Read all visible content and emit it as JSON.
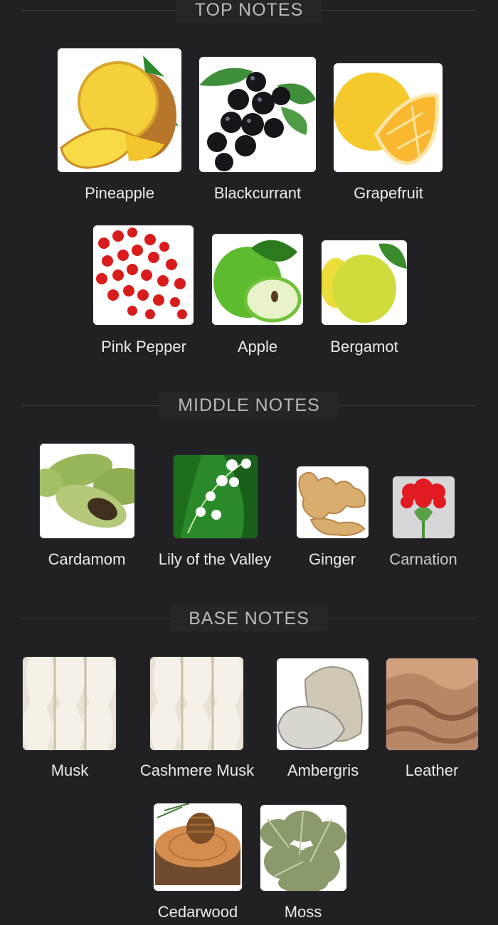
{
  "sections": {
    "top": {
      "title": "TOP NOTES",
      "notes": [
        {
          "name": "Pineapple",
          "icon": "pineapple-icon"
        },
        {
          "name": "Blackcurrant",
          "icon": "blackcurrant-icon"
        },
        {
          "name": "Grapefruit",
          "icon": "grapefruit-icon"
        },
        {
          "name": "Pink Pepper",
          "icon": "pink-pepper-icon"
        },
        {
          "name": "Apple",
          "icon": "apple-icon"
        },
        {
          "name": "Bergamot",
          "icon": "bergamot-icon"
        }
      ]
    },
    "middle": {
      "title": "MIDDLE NOTES",
      "notes": [
        {
          "name": "Cardamom",
          "icon": "cardamom-icon"
        },
        {
          "name": "Lily of the Valley",
          "icon": "lily-of-the-valley-icon"
        },
        {
          "name": "Ginger",
          "icon": "ginger-icon"
        },
        {
          "name": "Carnation",
          "icon": "carnation-icon"
        }
      ]
    },
    "base": {
      "title": "BASE NOTES",
      "notes": [
        {
          "name": "Musk",
          "icon": "musk-icon"
        },
        {
          "name": "Cashmere Musk",
          "icon": "cashmere-musk-icon"
        },
        {
          "name": "Ambergris",
          "icon": "ambergris-icon"
        },
        {
          "name": "Leather",
          "icon": "leather-icon"
        },
        {
          "name": "Cedarwood",
          "icon": "cedarwood-icon"
        },
        {
          "name": "Moss",
          "icon": "moss-icon"
        }
      ]
    }
  },
  "colors": {
    "background": "#212125",
    "heading": "#b9b9be",
    "label": "#ebebee"
  }
}
